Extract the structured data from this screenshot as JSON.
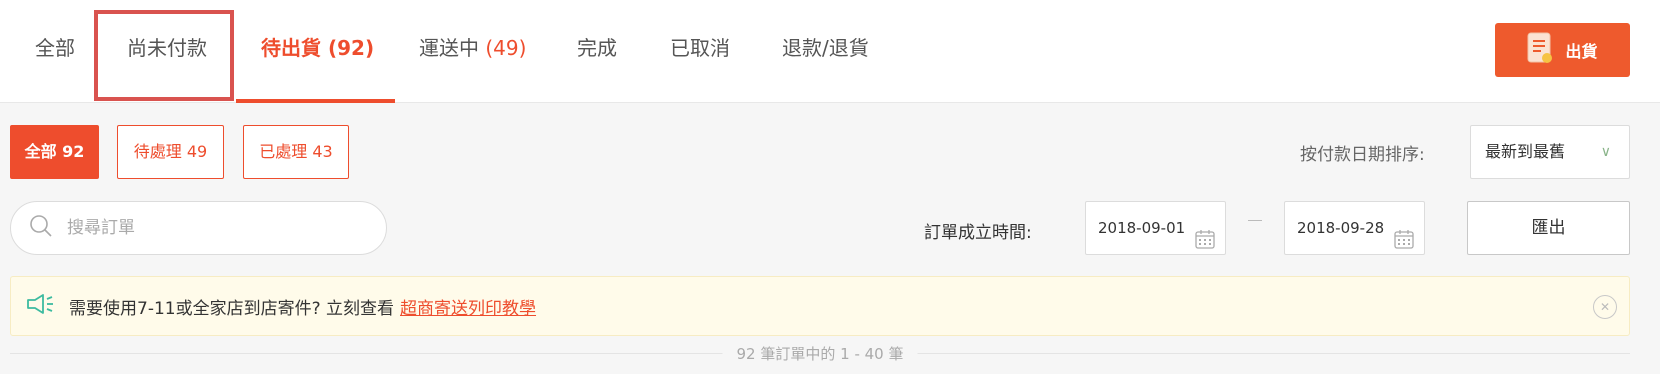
{
  "tabs": [
    {
      "label": "全部",
      "count": ""
    },
    {
      "label": "尚未付款",
      "count": ""
    },
    {
      "label": "待出貨",
      "count": "(92)"
    },
    {
      "label": "運送中",
      "count": "(49)"
    },
    {
      "label": "完成",
      "count": ""
    },
    {
      "label": "已取消",
      "count": ""
    },
    {
      "label": "退款/退貨",
      "count": ""
    }
  ],
  "active_tab": "待出貨",
  "ship_button": {
    "label": "出貨",
    "icon": "document-icon"
  },
  "filters": [
    {
      "label": "全部 92",
      "active": true
    },
    {
      "label": "待處理 49",
      "active": false
    },
    {
      "label": "已處理 43",
      "active": false
    }
  ],
  "sort": {
    "label": "按付款日期排序:",
    "selected": "最新到最舊"
  },
  "search": {
    "placeholder": "搜尋訂單",
    "value": ""
  },
  "date_range": {
    "label": "訂單成立時間:",
    "from": "2018-09-01",
    "to": "2018-09-28"
  },
  "export_button": {
    "label": "匯出"
  },
  "notice": {
    "text": "需要使用7-11或全家店到店寄件? 立刻查看",
    "link": "超商寄送列印教學",
    "icon": "megaphone-icon"
  },
  "summary": "92 筆訂單中的 1 - 40 筆",
  "colors": {
    "accent": "#ee4d2d",
    "highlight": "#d9534f",
    "notice_bg": "#fffbea"
  }
}
